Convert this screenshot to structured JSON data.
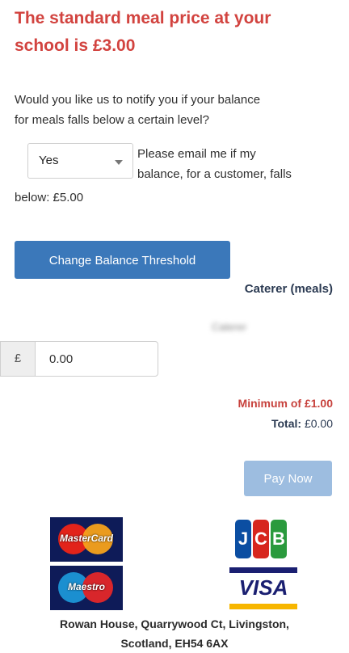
{
  "heading": {
    "line1": "The standard meal price at your",
    "line2": "school is £3.00",
    "color": "#d2433f"
  },
  "notify": {
    "line1": "Would you like us to notify you if your balance",
    "line2": "for meals falls below a certain level?"
  },
  "threshold_select": {
    "selected": "Yes",
    "icon": "chevron-down-icon"
  },
  "email_text": {
    "line1": "Please email me if my",
    "line2": "balance, for a customer, falls",
    "line3": "below: £5.00"
  },
  "buttons": {
    "change_threshold": "Change Balance Threshold",
    "pay_now": "Pay Now"
  },
  "caterer": {
    "label": "Caterer (meals)",
    "blurred_name": "Caterer"
  },
  "amount": {
    "currency_symbol": "£",
    "value": "0.00"
  },
  "minimum_text": "Minimum of £1.00",
  "total": {
    "label": "Total:",
    "value": "£0.00"
  },
  "cards": {
    "mastercard": "MasterCard",
    "maestro": "Maestro",
    "jcb": [
      "J",
      "C",
      "B"
    ],
    "visa": "VISA"
  },
  "address": {
    "line1": "Rowan House, Quarrywood Ct, Livingston,",
    "line2": "Scotland, EH54 6AX"
  },
  "colors": {
    "primary_button": "#3b78ba",
    "disabled_button": "#9dbde0",
    "error_text": "#c7413c"
  }
}
